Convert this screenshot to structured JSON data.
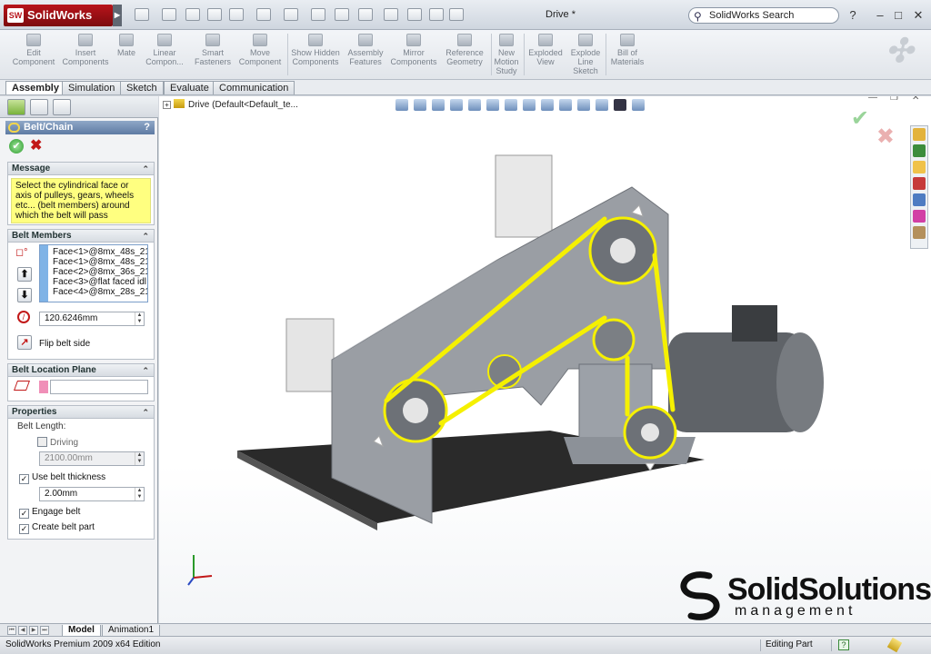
{
  "app": {
    "name": "SolidWorks",
    "logo_short": "SW",
    "document_title": "Drive *",
    "search_placeholder": "SolidWorks Search",
    "help_icon": "?",
    "window_min": "–",
    "window_max": "□",
    "window_close": "✕"
  },
  "commands": [
    {
      "label": "Edit Component",
      "icon": "edit-component-icon"
    },
    {
      "label": "Insert Components",
      "icon": "insert-components-icon"
    },
    {
      "label": "Mate",
      "icon": "mate-icon"
    },
    {
      "label": "Linear Compon...",
      "icon": "linear-pattern-icon"
    },
    {
      "label": "Smart Fasteners",
      "icon": "smart-fasteners-icon"
    },
    {
      "label": "Move Component",
      "icon": "move-component-icon"
    },
    {
      "label": "Show Hidden Components",
      "icon": "show-hidden-icon"
    },
    {
      "label": "Assembly Features",
      "icon": "assembly-features-icon"
    },
    {
      "label": "Mirror Components",
      "icon": "mirror-components-icon"
    },
    {
      "label": "Reference Geometry",
      "icon": "reference-geometry-icon"
    },
    {
      "label": "New Motion Study",
      "icon": "motion-study-icon"
    },
    {
      "label": "Exploded View",
      "icon": "exploded-view-icon"
    },
    {
      "label": "Explode Line Sketch",
      "icon": "explode-line-icon"
    },
    {
      "label": "Bill of Materials",
      "icon": "bom-icon"
    }
  ],
  "tabs": [
    "Assembly",
    "Simulation",
    "Sketch",
    "Evaluate",
    "Communication"
  ],
  "property_manager": {
    "title": "Belt/Chain",
    "help": "?",
    "ok": "✔",
    "cancel": "✖",
    "message_title": "Message",
    "message_text": "Select the cylindrical face or axis of pulleys, gears, wheels etc... (belt members) around which the belt will pass",
    "members_title": "Belt Members",
    "members": [
      "Face<1>@8mx_48s_21-",
      "Face<1>@8mx_48s_21-",
      "Face<2>@8mx_36s_21-",
      "Face<3>@flat faced idl",
      "Face<4>@8mx_28s_21-"
    ],
    "pitch_diameter": "120.6246mm",
    "flip_label": "Flip belt side",
    "plane_title": "Belt Location Plane",
    "plane_value": "",
    "properties_title": "Properties",
    "belt_length_label": "Belt Length:",
    "driving_label": "Driving",
    "driving_checked": false,
    "belt_length_value": "2100.00mm",
    "thickness_label": "Use belt thickness",
    "thickness_checked": true,
    "thickness_value": "2.00mm",
    "engage_label": "Engage belt",
    "engage_checked": true,
    "create_part_label": "Create belt part",
    "create_part_checked": true
  },
  "graphics": {
    "tree_item": "Drive  (Default<Default_te...",
    "brand_name": "SolidSolutions",
    "brand_sub": "management"
  },
  "bottom_tabs": [
    "Model",
    "Animation1"
  ],
  "status": {
    "text": "SolidWorks Premium 2009 x64 Edition",
    "mode": "Editing Part",
    "help": "?"
  },
  "colors": {
    "belt": "#f5f000",
    "accent": "#5e7aa3",
    "brand_red": "#b8141b"
  }
}
